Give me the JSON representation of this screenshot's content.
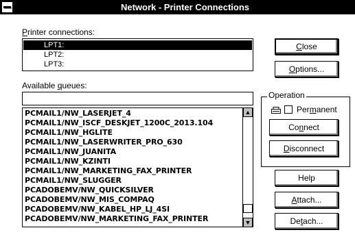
{
  "window": {
    "title": "Network - Printer Connections"
  },
  "printer_connections": {
    "label": "Printer connections:",
    "items": [
      {
        "label": "LPT1:",
        "selected": true
      },
      {
        "label": "LPT2:",
        "selected": false
      },
      {
        "label": "LPT3:",
        "selected": false
      }
    ]
  },
  "available_queues": {
    "label": "Available queues:",
    "input_value": "",
    "items": [
      "PCMAIL1/NW_LASERJET_4",
      "PCMAIL1/NW_ISCF_DESKJET_1200C_2013.104",
      "PCMAIL1/NW_HGLITE",
      "PCMAIL1/NW_LASERWRITER_PRO_630",
      "PCMAIL1/NW_JUANITA",
      "PCMAIL1/NW_KZINTI",
      "PCMAIL1/NW_MARKETING_FAX_PRINTER",
      "PCMAIL1/NW_SLUGGER",
      "PCADOBEMV/NW_QUICKSILVER",
      "PCADOBEMV/NW_MIS_COMPAQ",
      "PCADOBEMV/NW_KABEL_HP_LJ_4SI",
      "PCADOBEMV/NW_MARKETING_FAX_PRINTER"
    ]
  },
  "buttons": {
    "close": "Close",
    "options": "Options...",
    "connect": "Connect",
    "disconnect": "Disconnect",
    "help": "Help",
    "attach": "Attach...",
    "detach": "Detach..."
  },
  "operation": {
    "label": "Operation",
    "permanent_label": "Permanent",
    "permanent_checked": false
  },
  "icons": {
    "system_menu": "system-menu-icon",
    "printer": "printer-icon",
    "scroll_up": "scroll-up-arrow-icon",
    "scroll_down": "scroll-down-arrow-icon"
  }
}
